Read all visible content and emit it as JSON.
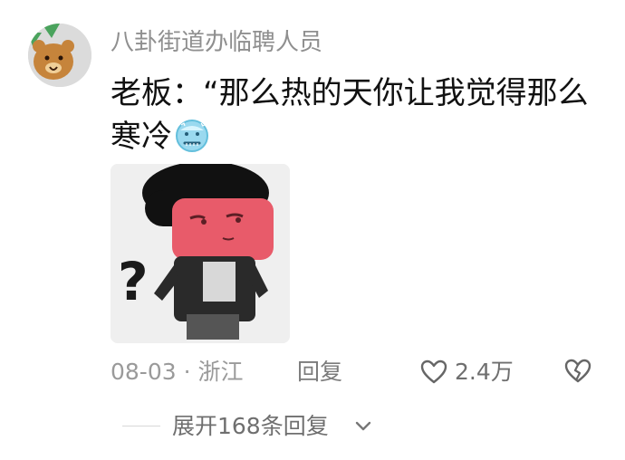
{
  "comment": {
    "username": "八卦街道办临聘人员",
    "text": "老板：“那么热的天你让我觉得那么寒冷",
    "emoji": "freezing-face-icon",
    "sticker": "confused-red-face-sticker",
    "date_location": "08-03 · 浙江",
    "reply_label": "回复",
    "likes": "2.4万",
    "expand_label": "展开168条回复"
  },
  "colors": {
    "username": "#8f8f8f",
    "text": "#111111",
    "meta": "#9a9a9a",
    "face": "#e85b6a",
    "emoji": "#8fd7ee"
  }
}
